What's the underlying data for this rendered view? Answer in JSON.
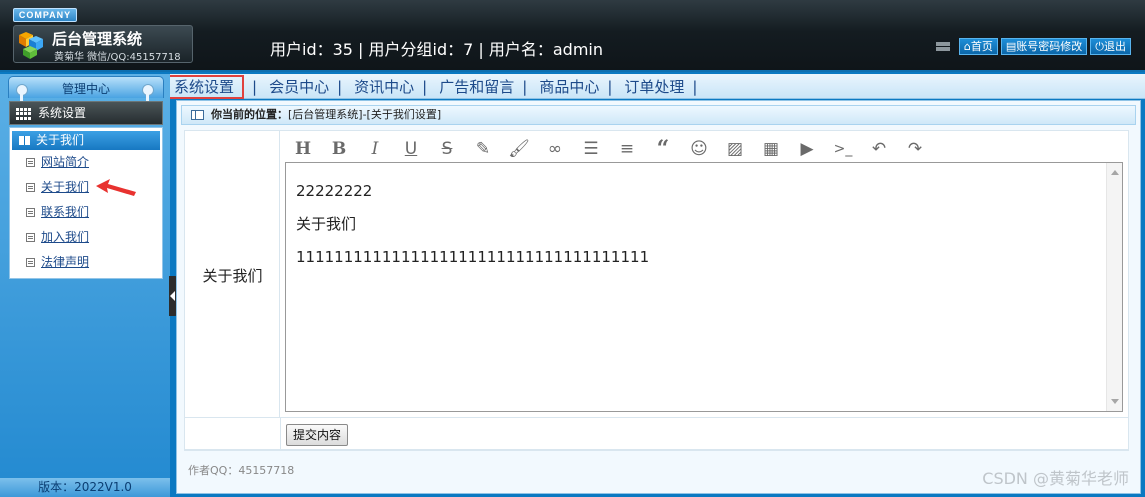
{
  "header": {
    "company_badge": "COMPANY",
    "system_title": "后台管理系统",
    "system_subtitle": "黄菊华 微信/QQ:45157718",
    "user_info": "用户id：35 | 用户分组id：7 | 用户名：admin",
    "links": [
      {
        "label": "首页",
        "icon": "home-icon"
      },
      {
        "label": "账号密码修改",
        "icon": "document-icon"
      },
      {
        "label": "退出",
        "icon": "power-icon"
      }
    ]
  },
  "nav": {
    "items": [
      "系统设置",
      "会员中心",
      "资讯中心",
      "广告和留言",
      "商品中心",
      "订单处理"
    ],
    "separator": "|",
    "active_index": 0
  },
  "sidebar": {
    "tab_label": "管理中心",
    "section_header": "系统设置",
    "panel_title": "关于我们",
    "links": [
      "网站简介",
      "关于我们",
      "联系我们",
      "加入我们",
      "法律声明"
    ],
    "version": "版本：2022V1.0"
  },
  "main": {
    "breadcrumb_label": "你当前的位置：",
    "breadcrumb_path": "[后台管理系统]-[关于我们设置]",
    "field_label": "关于我们",
    "editor_lines": [
      "22222222",
      "关于我们",
      "1111111111111111111111111111111111111"
    ],
    "toolbar": [
      "heading-icon",
      "bold-icon",
      "italic-icon",
      "underline-icon",
      "strikethrough-icon",
      "pen-icon",
      "brush-icon",
      "link-icon",
      "list-icon",
      "align-icon",
      "quote-icon",
      "emoji-icon",
      "image-icon",
      "table-icon",
      "video-icon",
      "code-icon",
      "undo-icon",
      "redo-icon"
    ],
    "submit_label": "提交内容",
    "author": "作者QQ：45157718"
  },
  "watermark": "CSDN @黄菊华老师",
  "colors": {
    "accent": "#0a79c2",
    "active_border": "#e0413e",
    "nav_text": "#1d4a8a"
  }
}
